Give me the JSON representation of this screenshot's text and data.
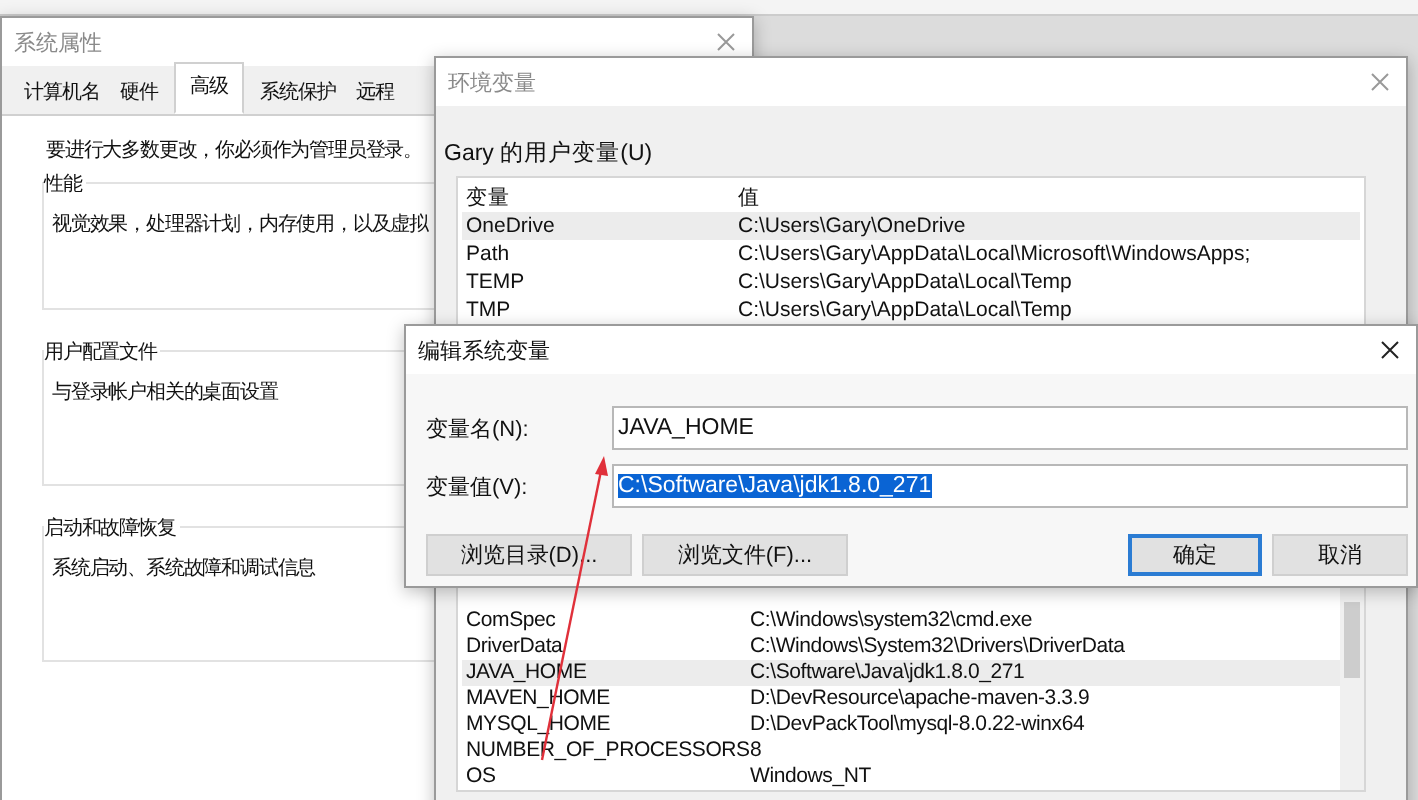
{
  "system_properties": {
    "title": "系统属性",
    "tabs": [
      {
        "label": "计算机名",
        "selected": false
      },
      {
        "label": "硬件",
        "selected": false
      },
      {
        "label": "高级",
        "selected": true
      },
      {
        "label": "系统保护",
        "selected": false
      },
      {
        "label": "远程",
        "selected": false
      }
    ],
    "notice": "要进行大多数更改，你必须作为管理员登录。",
    "groups": [
      {
        "title": "性能",
        "description": "视觉效果，处理器计划，内存使用，以及虚拟"
      },
      {
        "title": "用户配置文件",
        "description": "与登录帐户相关的桌面设置"
      },
      {
        "title": "启动和故障恢复",
        "description": "系统启动、系统故障和调试信息"
      }
    ]
  },
  "environment_variables": {
    "title": "环境变量",
    "user_section_label": "Gary 的用户变量(U)",
    "user_variables": {
      "columns": [
        "变量",
        "值"
      ],
      "rows": [
        {
          "name": "OneDrive",
          "value": "C:\\Users\\Gary\\OneDrive",
          "selected": true
        },
        {
          "name": "Path",
          "value": "C:\\Users\\Gary\\AppData\\Local\\Microsoft\\WindowsApps;",
          "selected": false
        },
        {
          "name": "TEMP",
          "value": "C:\\Users\\Gary\\AppData\\Local\\Temp",
          "selected": false
        },
        {
          "name": "TMP",
          "value": "C:\\Users\\Gary\\AppData\\Local\\Temp",
          "selected": false
        }
      ]
    },
    "system_variables": {
      "rows": [
        {
          "name": "ComSpec",
          "value": "C:\\Windows\\system32\\cmd.exe",
          "selected": false
        },
        {
          "name": "DriverData",
          "value": "C:\\Windows\\System32\\Drivers\\DriverData",
          "selected": false
        },
        {
          "name": "JAVA_HOME",
          "value": "C:\\Software\\Java\\jdk1.8.0_271",
          "selected": true
        },
        {
          "name": "MAVEN_HOME",
          "value": "D:\\DevResource\\apache-maven-3.3.9",
          "selected": false
        },
        {
          "name": "MYSQL_HOME",
          "value": "D:\\DevPackTool\\mysql-8.0.22-winx64",
          "selected": false
        },
        {
          "name": "NUMBER_OF_PROCESSORS",
          "value": "8",
          "selected": false
        },
        {
          "name": "OS",
          "value": "Windows_NT",
          "selected": false
        }
      ]
    }
  },
  "edit_dialog": {
    "title": "编辑系统变量",
    "fields": [
      {
        "label": "变量名(N):",
        "value": "JAVA_HOME",
        "selected": false
      },
      {
        "label": "变量值(V):",
        "value": "C:\\Software\\Java\\jdk1.8.0_271",
        "selected": true
      }
    ],
    "buttons": [
      {
        "label": "浏览目录(D)...",
        "default": false
      },
      {
        "label": "浏览文件(F)...",
        "default": false
      },
      {
        "label": "确定",
        "default": true
      },
      {
        "label": "取消",
        "default": false
      }
    ]
  }
}
